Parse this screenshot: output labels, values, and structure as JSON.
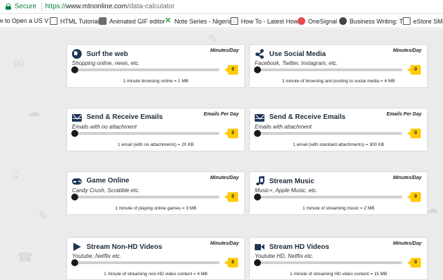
{
  "address_bar": {
    "secure_label": "Secure",
    "url_scheme": "https://",
    "url_host": "www.mtnonline.com",
    "url_path": "/data-calculator"
  },
  "bookmarks": [
    {
      "label": "w to Open a US V",
      "icon": "page-icon"
    },
    {
      "label": "HTML Tutorial",
      "icon": "document-icon"
    },
    {
      "label": "Animated GIF editor",
      "icon": "image-icon"
    },
    {
      "label": "Note Series - Nigeria",
      "icon": "x-icon"
    },
    {
      "label": "How To - Latest How",
      "icon": "tv-icon"
    },
    {
      "label": "OneSignal",
      "icon": "onesignal-icon"
    },
    {
      "label": "Business Writing: Tha",
      "icon": "page-icon"
    },
    {
      "label": "eStore SMS",
      "icon": "document-icon"
    }
  ],
  "cards": [
    {
      "title": "Surf the web",
      "unit": "Minutes/Day",
      "subtitle": "Shopping online, news, etc.",
      "value": "0",
      "note": "1 minute browsing online = 1 MB",
      "icon": "globe-icon"
    },
    {
      "title": "Use Social Media",
      "unit": "Minutes/Day",
      "subtitle": "Facebook, Twitter, Instagram, etc.",
      "value": "0",
      "note": "1 minute of browsing and posting to social media = 4 MB",
      "icon": "share-icon"
    },
    {
      "title": "Send & Receive Emails",
      "unit": "Emails Per Day",
      "subtitle": "Emails with no attachment",
      "value": "0",
      "note": "1 email (with no attachments) = 20 KB",
      "icon": "envelope-icon"
    },
    {
      "title": "Send & Receive Emails",
      "unit": "Emails Per Day",
      "subtitle": "Emails with attachment",
      "value": "0",
      "note": "1 email (with standard attachments) = 300 KB",
      "icon": "envelope-icon"
    },
    {
      "title": "Game Online",
      "unit": "Minutes/Day",
      "subtitle": "Candy Crush, Scrabble etc.",
      "value": "0",
      "note": "1 minute of playing online games = 3 MB",
      "icon": "gamepad-icon"
    },
    {
      "title": "Stream Music",
      "unit": "Minutes/Day",
      "subtitle": "Music+, Apple Music, etc.",
      "value": "0",
      "note": "1 minute of streaming music = 2 MB",
      "icon": "music-icon"
    },
    {
      "title": "Stream Non-HD Videos",
      "unit": "Minutes/Day",
      "subtitle": "Youtube, Netflix etc.",
      "value": "0",
      "note": "1 minute of streaming non-HD video content = 4 MB",
      "icon": "play-icon"
    },
    {
      "title": "Stream HD Videos",
      "unit": "Minutes/Day",
      "subtitle": "Youtube HD, Netflix etc.",
      "value": "0",
      "note": "1 minute of streaming HD video content = 15 MB",
      "icon": "video-camera-icon"
    }
  ],
  "colors": {
    "badge": "#ffcb05",
    "icon": "#1d3557",
    "secure_green": "#0b8043",
    "background": "#ebebeb"
  }
}
